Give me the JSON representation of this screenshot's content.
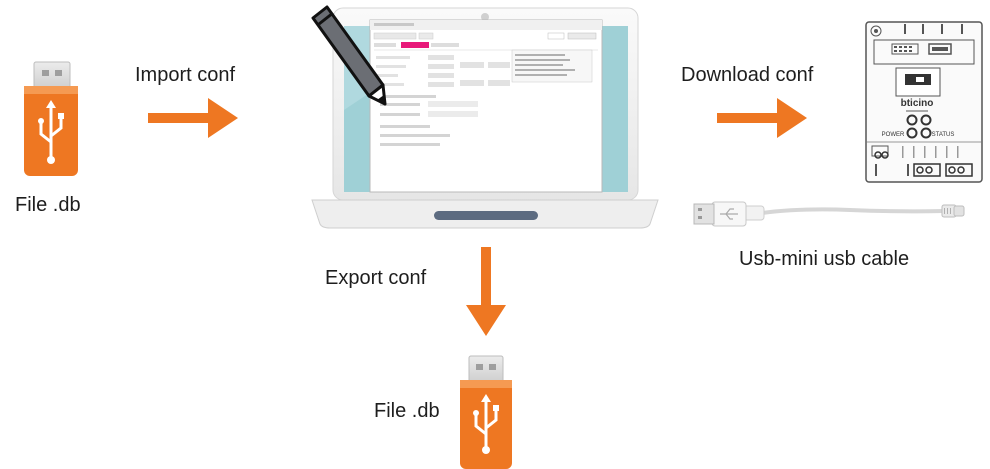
{
  "labels": {
    "import": "Import conf",
    "download": "Download conf",
    "export": "Export conf",
    "file_left": "File .db",
    "file_bottom": "File .db",
    "cable": "Usb-mini usb cable"
  },
  "device": {
    "brand": "bticino",
    "power": "POWER",
    "status": "STATUS"
  },
  "colors": {
    "arrow": "#ee7722",
    "usb_body": "#ee7722",
    "screen_bg": "#9fd0d6",
    "laptop_frame": "#f4f4f4"
  },
  "icons": [
    "usb-stick-icon",
    "usb-stick-icon",
    "laptop-icon",
    "pencil-icon",
    "device-module-icon",
    "usb-cable-icon",
    "arrow-icon"
  ]
}
